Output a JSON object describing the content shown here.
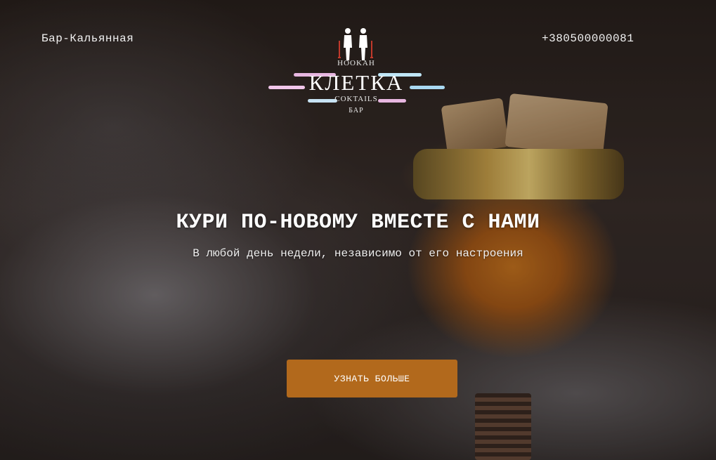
{
  "header": {
    "venue_type": "Бар-Кальянная",
    "phone": "+380500000081"
  },
  "logo": {
    "top_text": "HOOKAH",
    "main_text": "КЛЕТКА",
    "sub_text": "COKTAILS",
    "bottom_text": "БАР"
  },
  "hero": {
    "headline": "КУРИ ПО-НОВОМУ ВМЕСТЕ С НАМИ",
    "subheadline": "В любой день недели, независимо от его настроения",
    "cta_label": "УЗНАТЬ БОЛЬШЕ"
  },
  "colors": {
    "accent": "#b2691c",
    "text": "#ffffff"
  }
}
